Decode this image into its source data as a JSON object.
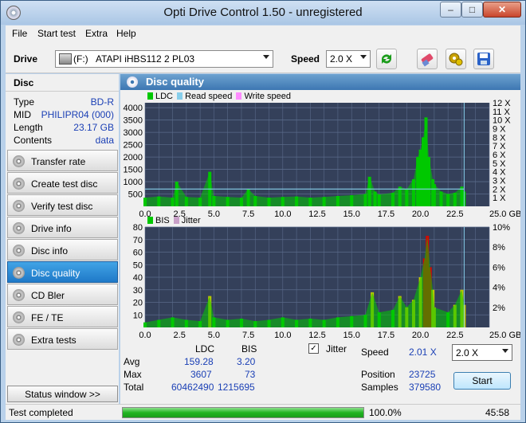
{
  "window": {
    "title": "Opti Drive Control 1.50 - unregistered",
    "min": "–",
    "max": "□",
    "close": "✕"
  },
  "menu": [
    "File",
    "Start test",
    "Extra",
    "Help"
  ],
  "toolbar": {
    "drive_label": "Drive",
    "drive_letter": "(F:)",
    "drive_name": "ATAPI iHBS112  2 PL03",
    "speed_label": "Speed",
    "speed_value": "2.0 X"
  },
  "icons": {
    "refresh": "refresh-icon",
    "eraser": "eraser-icon",
    "settings": "settings-icon",
    "save": "save-icon"
  },
  "disc": {
    "header": "Disc",
    "type_label": "Type",
    "type": "BD-R",
    "mid_label": "MID",
    "mid": "PHILIPR04 (000)",
    "length_label": "Length",
    "length": "23.17 GB",
    "contents_label": "Contents",
    "contents": "data"
  },
  "nav": [
    {
      "label": "Transfer rate",
      "active": false
    },
    {
      "label": "Create test disc",
      "active": false
    },
    {
      "label": "Verify test disc",
      "active": false
    },
    {
      "label": "Drive info",
      "active": false
    },
    {
      "label": "Disc info",
      "active": false
    },
    {
      "label": "Disc quality",
      "active": true
    },
    {
      "label": "CD Bler",
      "active": false
    },
    {
      "label": "FE / TE",
      "active": false
    },
    {
      "label": "Extra tests",
      "active": false
    }
  ],
  "status_window_btn": "Status window >>",
  "panel_title": "Disc quality",
  "colors": {
    "ldc": "#00c800",
    "read": "#87ceeb",
    "write": "#ff8cff",
    "bis": "#00c800",
    "jitter": "#c8a0c8",
    "plot_bg": "#34405a",
    "grid": "#5a6a8a",
    "burst": "#dd0000",
    "mid": "#c8c800"
  },
  "chart_data": [
    {
      "type": "area",
      "legend": [
        "LDC",
        "Read speed",
        "Write speed"
      ],
      "x_ticks": [
        "0.0",
        "2.5",
        "5.0",
        "7.5",
        "10.0",
        "12.5",
        "15.0",
        "17.5",
        "20.0",
        "22.5",
        "25.0 GB"
      ],
      "y_ticks": [
        "500",
        "1000",
        "1500",
        "2000",
        "2500",
        "3000",
        "3500",
        "4000"
      ],
      "y2_ticks": [
        "1 X",
        "2 X",
        "3 X",
        "4 X",
        "5 X",
        "6 X",
        "7 X",
        "8 X",
        "9 X",
        "10 X",
        "11 X",
        "12 X"
      ],
      "xlim": [
        0,
        25
      ],
      "ylim": [
        0,
        4200
      ],
      "series": [
        {
          "name": "LDC",
          "x": [
            0,
            1,
            2,
            2.3,
            3,
            4,
            4.7,
            5,
            6,
            7,
            7.5,
            8,
            9,
            10,
            11,
            12,
            13,
            14,
            15,
            16,
            16.3,
            16.7,
            17,
            18,
            18.5,
            19,
            19.5,
            19.8,
            20,
            20.2,
            20.4,
            20.6,
            20.9,
            21,
            21.5,
            22,
            22.5,
            23,
            23.17
          ],
          "y": [
            350,
            400,
            350,
            1000,
            380,
            350,
            1400,
            420,
            380,
            350,
            700,
            420,
            350,
            380,
            400,
            350,
            380,
            420,
            450,
            500,
            1200,
            600,
            480,
            550,
            800,
            700,
            1100,
            2000,
            2300,
            2800,
            3607,
            2000,
            1100,
            900,
            600,
            500,
            550,
            800,
            600
          ]
        },
        {
          "name": "Read speed",
          "x": [
            0,
            23.17
          ],
          "y": [
            2.0,
            2.0
          ]
        }
      ]
    },
    {
      "type": "area",
      "legend": [
        "BIS",
        "Jitter"
      ],
      "x_ticks": [
        "0.0",
        "2.5",
        "5.0",
        "7.5",
        "10.0",
        "12.5",
        "15.0",
        "17.5",
        "20.0",
        "22.5",
        "25.0 GB"
      ],
      "y_ticks": [
        "10",
        "20",
        "30",
        "40",
        "50",
        "60",
        "70",
        "80"
      ],
      "y2_ticks": [
        "2%",
        "4%",
        "6%",
        "8%",
        "10%"
      ],
      "xlim": [
        0,
        25
      ],
      "ylim": [
        0,
        80
      ],
      "series": [
        {
          "name": "BIS",
          "x": [
            0,
            1,
            2,
            3,
            4,
            4.7,
            5,
            6,
            7,
            8,
            9,
            10,
            11,
            12,
            13,
            14,
            15,
            16,
            16.5,
            17,
            18,
            18.5,
            19,
            19.5,
            20,
            20.3,
            20.5,
            20.7,
            20.9,
            21,
            22,
            22.5,
            23,
            23.17
          ],
          "y": [
            4,
            6,
            8,
            6,
            5,
            25,
            8,
            6,
            7,
            5,
            6,
            8,
            6,
            7,
            6,
            8,
            9,
            10,
            28,
            12,
            14,
            25,
            16,
            22,
            40,
            55,
            73,
            48,
            30,
            16,
            12,
            18,
            30,
            18
          ]
        }
      ]
    }
  ],
  "stats": {
    "col_ldc": "LDC",
    "col_bis": "BIS",
    "avg_label": "Avg",
    "avg_ldc": "159.28",
    "avg_bis": "3.20",
    "max_label": "Max",
    "max_ldc": "3607",
    "max_bis": "73",
    "total_label": "Total",
    "total_ldc": "60462490",
    "total_bis": "1215695",
    "jitter_label": "Jitter",
    "jitter_checked": "✓",
    "speed_label": "Speed",
    "speed": "2.01 X",
    "speed_select": "2.0 X",
    "position_label": "Position",
    "position": "23725",
    "samples_label": "Samples",
    "samples": "379580",
    "start": "Start"
  },
  "status": {
    "text": "Test completed",
    "progress": "100.0%",
    "progress_value": 1.0,
    "time": "45:58"
  }
}
